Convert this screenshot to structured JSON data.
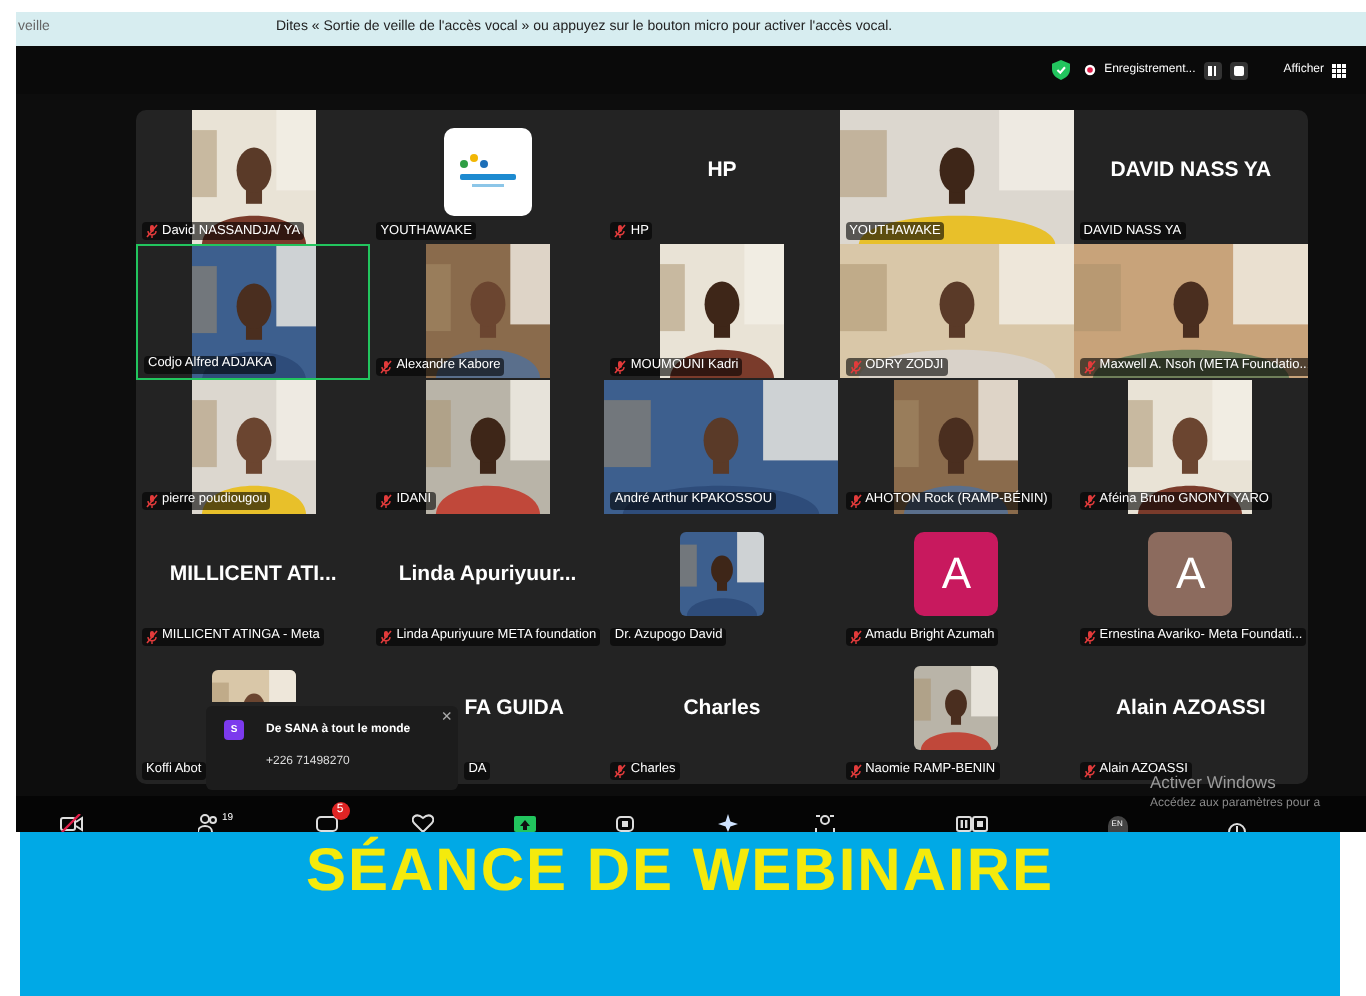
{
  "voice_bar": {
    "left_text": "veille",
    "message": "Dites « Sortie de veille de l'accès vocal » ou appuyez sur le bouton micro pour activer l'accès vocal."
  },
  "meeting_bar": {
    "recording_label": "Enregistrement...",
    "view_label": "Afficher"
  },
  "tiles": [
    {
      "kind": "video",
      "label": "David NASSANDJA/ YA",
      "muted": true,
      "speaking": false
    },
    {
      "kind": "logo",
      "label": "YOUTHAWAKE",
      "muted": false,
      "speaking": false
    },
    {
      "kind": "name",
      "title": "HP",
      "label": "HP",
      "muted": true,
      "speaking": false
    },
    {
      "kind": "video_wide",
      "label": "YOUTHAWAKE",
      "muted": false,
      "speaking": false
    },
    {
      "kind": "name",
      "title": "DAVID NASS YA",
      "label": "DAVID NASS YA",
      "muted": false,
      "speaking": false
    },
    {
      "kind": "video",
      "label": "Codjo Alfred ADJAKA",
      "muted": false,
      "speaking": true
    },
    {
      "kind": "video",
      "label": "Alexandre Kabore",
      "muted": true,
      "speaking": false
    },
    {
      "kind": "video",
      "label": "MOUMOUNI Kadri",
      "muted": true,
      "speaking": false
    },
    {
      "kind": "video_wide",
      "label": "ODRY ZODJI",
      "muted": true,
      "speaking": false
    },
    {
      "kind": "video_wide",
      "label": "Maxwell A. Nsoh (META Foundatio...",
      "muted": true,
      "speaking": false
    },
    {
      "kind": "video",
      "label": "pierre poudiougou",
      "muted": true,
      "speaking": false
    },
    {
      "kind": "video",
      "label": "IDANI",
      "muted": true,
      "speaking": false
    },
    {
      "kind": "video_wide",
      "label": "André Arthur KPAKOSSOU",
      "muted": false,
      "speaking": false
    },
    {
      "kind": "video",
      "label": "AHOTON Rock (RAMP-BÉNIN)",
      "muted": true,
      "speaking": false
    },
    {
      "kind": "video",
      "label": "Aféina Bruno GNONYI YARO",
      "muted": true,
      "speaking": false
    },
    {
      "kind": "name",
      "title": "MILLICENT  ATI...",
      "label": "MILLICENT ATINGA - Meta",
      "muted": true,
      "speaking": false
    },
    {
      "kind": "name",
      "title": "Linda  Apuriyuur...",
      "label": "Linda Apuriyuure META foundation",
      "muted": true,
      "speaking": false
    },
    {
      "label": "Dr. Azupogo David",
      "muted": false,
      "speaking": false
    },
    {
      "kind": "avatar",
      "letter": "A",
      "color": "#c8195e",
      "label": "Amadu Bright Azumah",
      "muted": true,
      "speaking": false
    },
    {
      "kind": "avatar",
      "letter": "A",
      "color": "#8c6b5e",
      "label": "Ernestina Avariko- Meta Foundati...",
      "muted": true,
      "speaking": false
    },
    {
      "kind": "photo_cut",
      "label": "Koffi Abot",
      "muted": false,
      "speaking": false
    },
    {
      "kind": "name_partial",
      "title": "FA GUIDA",
      "label": "DA",
      "muted": false,
      "speaking": false
    },
    {
      "kind": "name",
      "title": "Charles",
      "label": "Charles",
      "muted": true,
      "speaking": false
    },
    {
      "label": "Naomie RAMP-BENIN",
      "muted": true,
      "speaking": false
    },
    {
      "kind": "name",
      "title": "Alain AZOASSI",
      "label": "Alain AZOASSI",
      "muted": true,
      "speaking": false
    }
  ],
  "chat_popup": {
    "avatar_letter": "S",
    "sender": "De SANA à tout le monde",
    "message": "+226 71498270",
    "close": "×"
  },
  "toolbar": {
    "participants_count": "19",
    "chat_badge": "5",
    "language": "EN"
  },
  "windows_notice": {
    "title": "Activer Windows",
    "text": "Accédez aux paramètres pour a"
  },
  "banner": {
    "text": "SÉANCE DE WEBINAIRE"
  }
}
